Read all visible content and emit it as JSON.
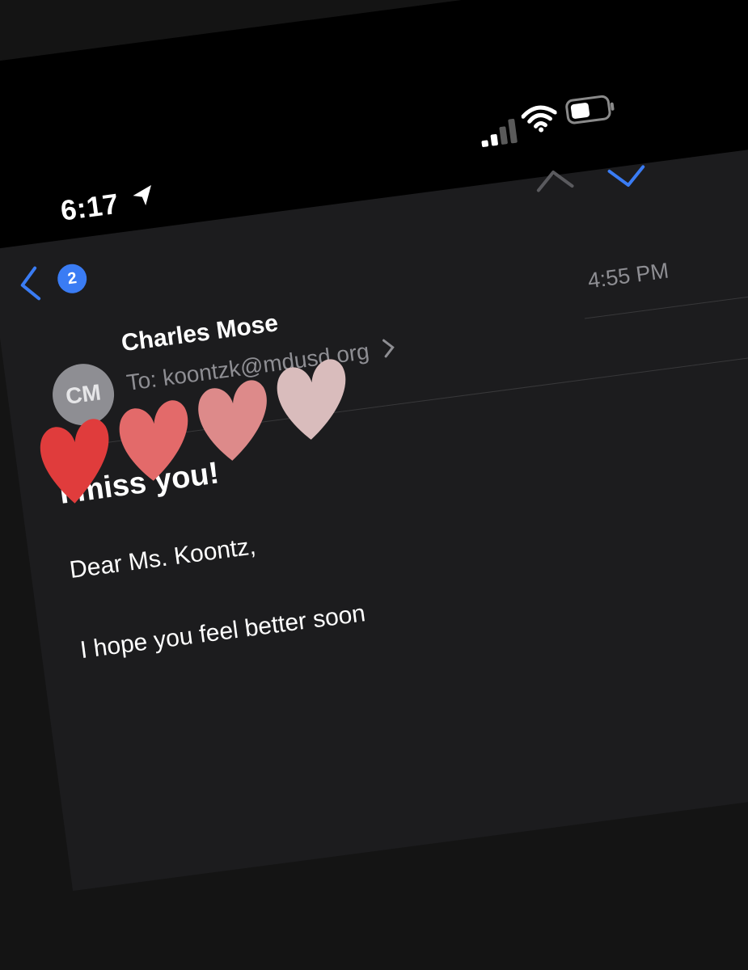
{
  "status_bar": {
    "time": "6:17",
    "icons": [
      "location-arrow-icon",
      "signal-icon",
      "wifi-icon",
      "battery-icon"
    ]
  },
  "toolbar": {
    "back_badge_count": "2",
    "icons": [
      "chevron-left-icon",
      "chevron-up-icon",
      "chevron-down-icon"
    ]
  },
  "message": {
    "received_time": "4:55 PM",
    "sender_initials": "CM",
    "sender_name": "Charles Mose",
    "to_label": "To:",
    "to_address": "koontzk@mdusd.org",
    "subject": "I miss you!",
    "body": [
      "Dear Ms. Koontz,",
      "I hope you feel better soon"
    ]
  },
  "colors": {
    "accent": "#3a7cf4",
    "background": "#1c1c1e",
    "status_bar": "#000000",
    "secondary_text": "#8e8e93",
    "hearts": [
      "#e03c3c",
      "#e36a6a",
      "#dd8a8a",
      "#d9bcbc"
    ]
  }
}
